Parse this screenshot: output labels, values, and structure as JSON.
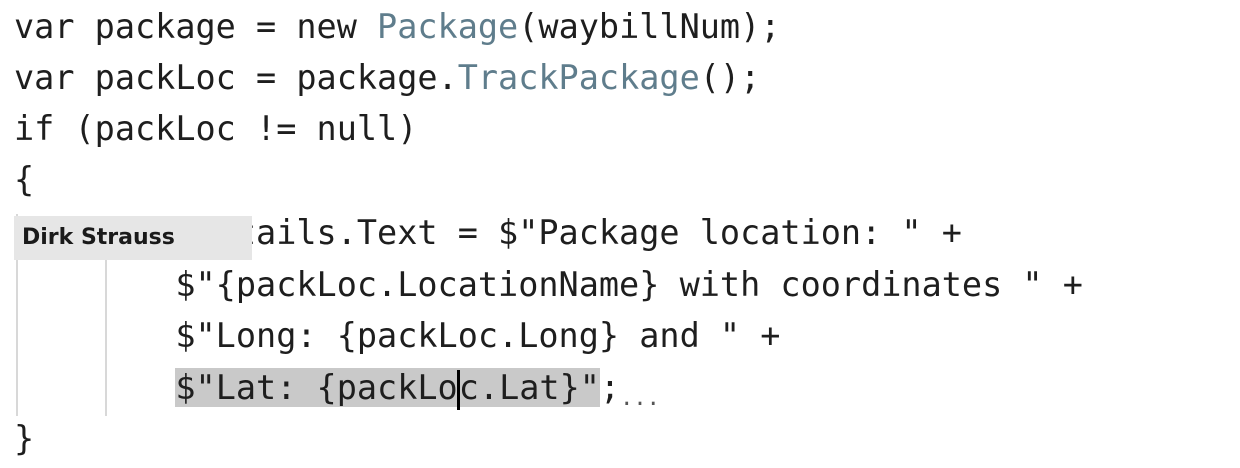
{
  "code": {
    "line1": {
      "pre": "var package = new ",
      "type": "Package",
      "post": "(waybillNum);"
    },
    "line2": {
      "pre": "var packLoc = package.",
      "method": "TrackPackage",
      "post": "();"
    },
    "line3": "if (packLoc != null)",
    "line4": "{",
    "line5": "    ationDetails.Text = $\"Package location: \" +",
    "line6": "        $\"{packLoc.LocationName} with coordinates \" +",
    "line7": "        $\"Long: {packLoc.Long} and \" +",
    "line8": {
      "indent": "        ",
      "selected_before_caret": "$\"Lat: {packLo",
      "selected_after_caret": "c.Lat}\"",
      "post": ";",
      "ellipsis": "..."
    },
    "line9": "}"
  },
  "author_tag": "Dirk Strauss",
  "colors": {
    "text": "#1e1e1e",
    "type_name": "#5f7d8c",
    "selection": "#c9c9c9",
    "author_tag_bg": "#e6e6e6"
  }
}
